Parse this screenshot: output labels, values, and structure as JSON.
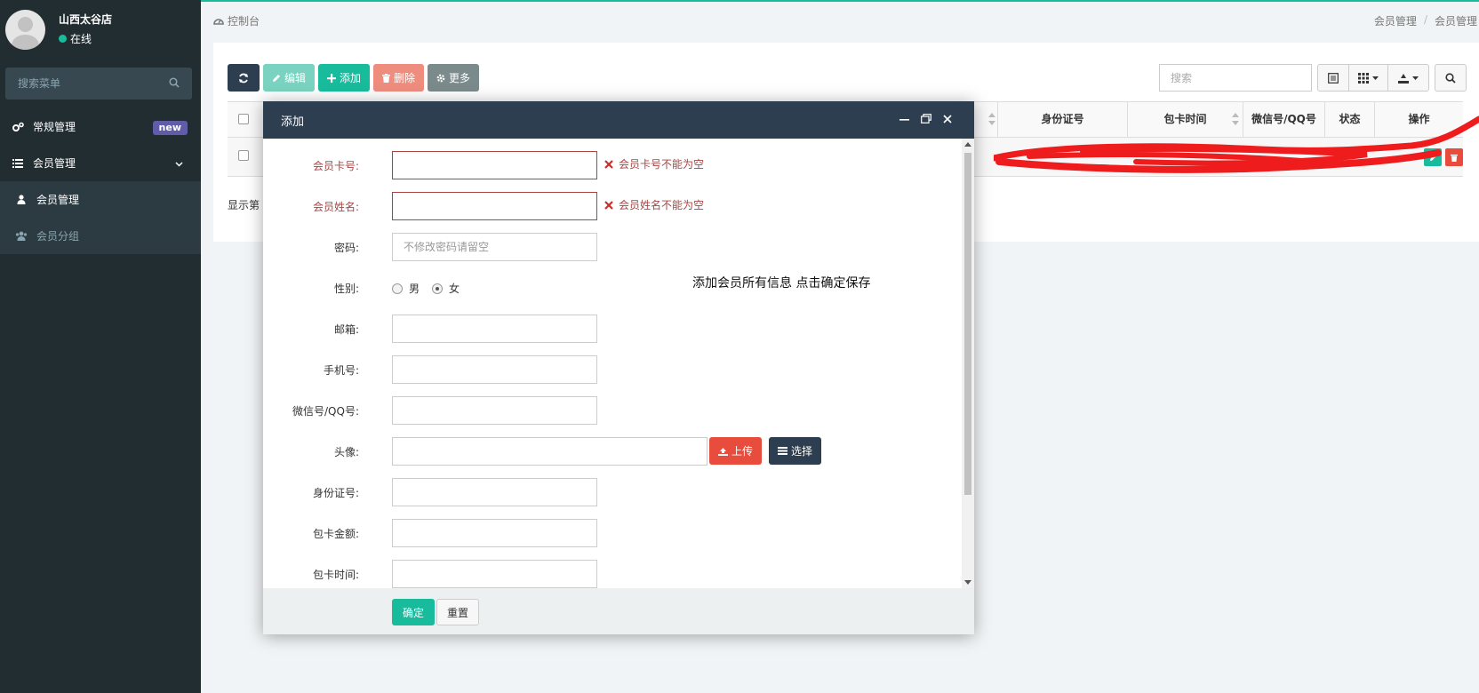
{
  "user": {
    "name": "山西太谷店",
    "status": "在线"
  },
  "sidebar": {
    "search_placeholder": "搜索菜单",
    "items": [
      {
        "label": "常规管理",
        "badge": "new"
      },
      {
        "label": "会员管理"
      },
      {
        "label": "会员管理"
      },
      {
        "label": "会员分组"
      }
    ]
  },
  "breadcrumb": {
    "left": "控制台",
    "right": [
      "会员管理",
      "会员管理"
    ]
  },
  "toolbar": {
    "edit_label": "编辑",
    "add_label": "添加",
    "delete_label": "删除",
    "more_label": "更多",
    "search_placeholder": "搜索"
  },
  "table": {
    "columns": [
      "身份证号",
      "包卡时间",
      "微信号/QQ号",
      "状态",
      "操作"
    ],
    "pager_text": "显示第"
  },
  "modal": {
    "title": "添加",
    "fields": {
      "card_no": {
        "label": "会员卡号:",
        "value": "",
        "error": "会员卡号不能为空"
      },
      "name": {
        "label": "会员姓名:",
        "value": "",
        "error": "会员姓名不能为空"
      },
      "password": {
        "label": "密码:",
        "placeholder": "不修改密码请留空"
      },
      "gender": {
        "label": "性别:",
        "options": [
          "男",
          "女"
        ],
        "selected": "女"
      },
      "email": {
        "label": "邮箱:",
        "value": ""
      },
      "mobile": {
        "label": "手机号:",
        "value": ""
      },
      "wechat": {
        "label": "微信号/QQ号:",
        "value": ""
      },
      "avatar": {
        "label": "头像:",
        "value": "",
        "upload_label": "上传",
        "choose_label": "选择"
      },
      "id_no": {
        "label": "身份证号:",
        "value": ""
      },
      "card_amount": {
        "label": "包卡金额:",
        "value": ""
      },
      "card_time": {
        "label": "包卡时间:",
        "value": ""
      }
    },
    "note": "添加会员所有信息 点击确定保存",
    "ok_label": "确定",
    "reset_label": "重置"
  },
  "colors": {
    "sidebar_bg": "#222d32",
    "accent": "#18bc9c",
    "dark": "#2c3e50",
    "danger": "#e74c3c",
    "error": "#a94442",
    "badge": "#605ca8"
  }
}
